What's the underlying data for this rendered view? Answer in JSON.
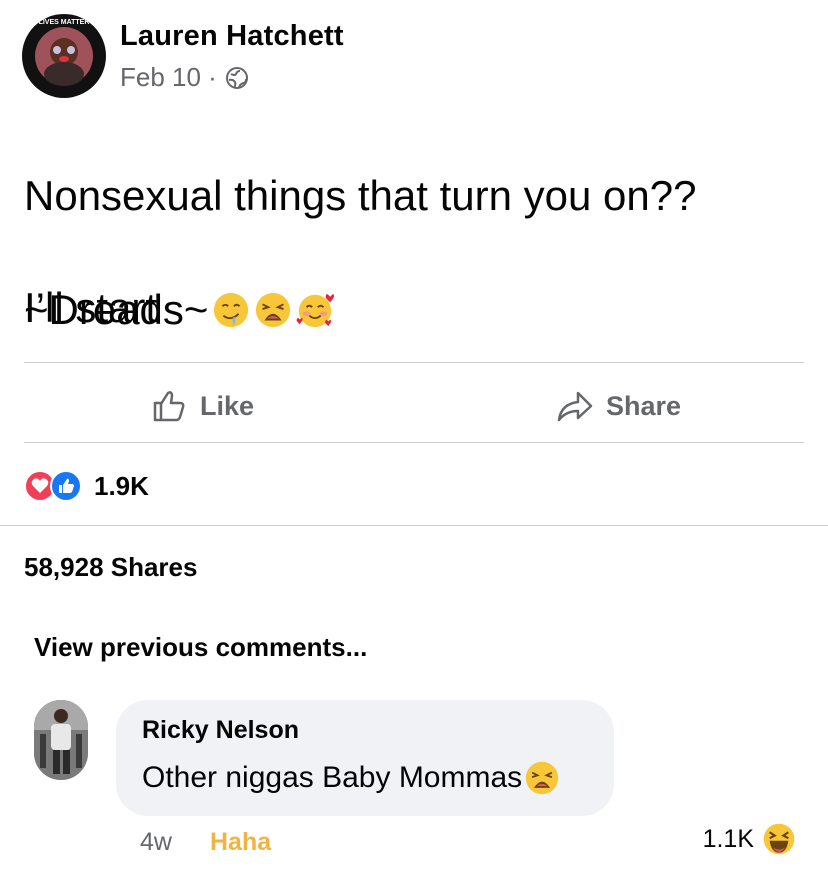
{
  "post": {
    "author": "Lauren Hatchett",
    "date": "Feb 10 ·",
    "privacy_icon": "globe-icon",
    "avatar_ring_text": "BLACK LIVES MATTER",
    "text_line1": "Nonsexual things that turn you on??",
    "text_line2": "I’ll start",
    "text_line3": "~Dreads~",
    "emojis": [
      "drooling-face",
      "weary-face",
      "smiling-face-with-hearts"
    ]
  },
  "actions": {
    "like_label": "Like",
    "share_label": "Share"
  },
  "reactions": {
    "count": "1.9K",
    "types": [
      "love",
      "like"
    ]
  },
  "shares_text": "58,928 Shares",
  "view_previous": "View previous comments...",
  "comment": {
    "author": "Ricky Nelson",
    "text": "Other niggas Baby Mommas",
    "emoji": "weary-face",
    "time": "4w",
    "reaction_label": "Haha",
    "reaction_count": "1.1K",
    "reaction_emoji": "laughing-face"
  },
  "colors": {
    "secondary_text": "#65676b",
    "bubble_bg": "#f0f2f5",
    "haha": "#f0b443",
    "like_blue": "#1877f2",
    "love_red": "#f33e58"
  }
}
